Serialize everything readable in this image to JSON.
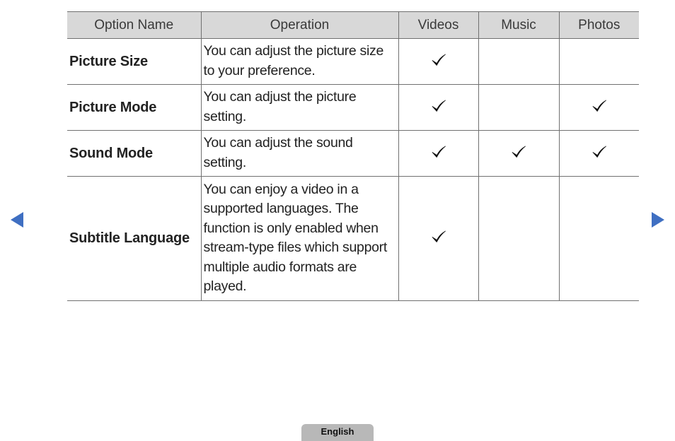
{
  "table": {
    "headers": [
      "Option Name",
      "Operation",
      "Videos",
      "Music",
      "Photos"
    ],
    "rows": [
      {
        "name": "Picture Size",
        "operation": "You can adjust the picture size to your preference.",
        "videos": true,
        "music": false,
        "photos": false
      },
      {
        "name": "Picture Mode",
        "operation": "You can adjust the picture setting.",
        "videos": true,
        "music": false,
        "photos": true
      },
      {
        "name": "Sound Mode",
        "operation": "You can adjust the sound setting.",
        "videos": true,
        "music": true,
        "photos": true
      },
      {
        "name": "Subtitle Language",
        "operation": "You can enjoy a video in a supported languages. The function is only enabled when stream-type files which support multiple audio formats are played.",
        "videos": true,
        "music": false,
        "photos": false
      }
    ]
  },
  "navigation": {
    "prev_icon": "triangle-left",
    "next_icon": "triangle-right",
    "arrow_color": "#3f6fc2"
  },
  "footer": {
    "language_label": "English"
  },
  "colors": {
    "option_name": "#4a72b8",
    "header_bg": "#d8d8d8",
    "border": "#707070"
  }
}
